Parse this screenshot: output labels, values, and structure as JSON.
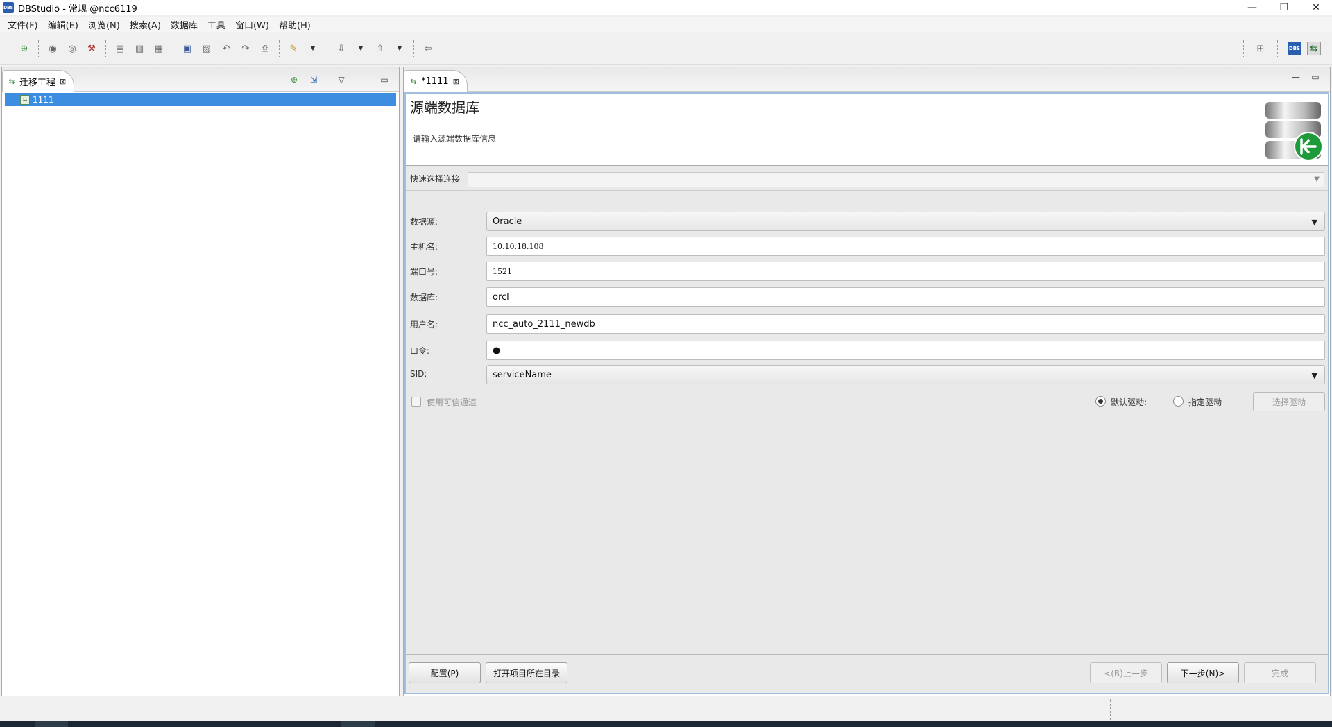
{
  "window": {
    "title": "DBStudio - 常规 @ncc6119",
    "app_icon_text": "DBS",
    "controls": [
      "—",
      "❐",
      "✕"
    ]
  },
  "menu": [
    "文件(F)",
    "编辑(E)",
    "浏览(N)",
    "搜索(A)",
    "数据库",
    "工具",
    "窗口(W)",
    "帮助(H)"
  ],
  "left_panel": {
    "tab_label": "迁移工程",
    "tree_items": [
      "1111"
    ]
  },
  "editor": {
    "tab_label": "*1111",
    "wizard": {
      "title": "源端数据库",
      "description": "请输入源端数据库信息",
      "quick_select_label": "快速选择连接",
      "quick_select_value": "",
      "fields": {
        "datasource": {
          "label": "数据源:",
          "value": "Oracle"
        },
        "host": {
          "label": "主机名:",
          "value": "10.10.18.108"
        },
        "port": {
          "label": "端口号:",
          "value": "1521"
        },
        "database": {
          "label": "数据库:",
          "value": "orcl"
        },
        "user": {
          "label": "用户名:",
          "value": "ncc_auto_2111_newdb"
        },
        "password": {
          "label": "口令:",
          "value": "●"
        },
        "sid": {
          "label": "SID:",
          "value": "serviceName"
        }
      },
      "trusted_channel_label": "使用可信通道",
      "default_driver_label": "默认驱动:",
      "specified_driver_label": "指定驱动",
      "select_driver_label": "选择驱动",
      "buttons": {
        "config": "配置(P)",
        "open_dir": "打开项目所在目录",
        "back": "<(B)上一步",
        "next": "下一步(N)>",
        "finish": "完成"
      }
    }
  },
  "colors": {
    "selection": "#3d8ee0",
    "wizard_border": "#9fbee0"
  }
}
